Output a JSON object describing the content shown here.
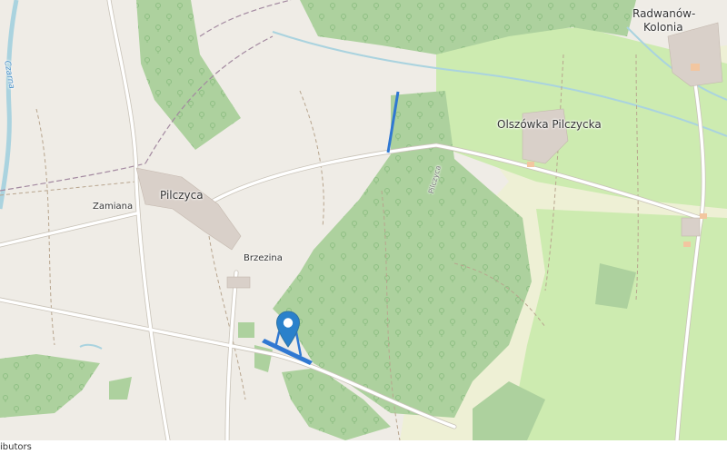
{
  "map": {
    "place_labels": {
      "pilczyca": "Pilczyca",
      "zamiana": "Zamiana",
      "brzezina": "Brzezina",
      "olszowka": "Olszówka Pilczycka",
      "radwanow_line1": "Radwanów-",
      "radwanow_line2": "Kolonia"
    },
    "water_label": "Czarna",
    "road_label": "Pilczyca",
    "colors": {
      "background": "#efece6",
      "forest": "#add19e",
      "farmland": "#eef0d5",
      "meadow": "#cdebb0",
      "road": "#ffffff",
      "river": "#aad3df",
      "marker": "#2a81cb",
      "highlight": "#3078d2"
    },
    "marker_icon": "map-pin-icon"
  },
  "attribution": "ibutors"
}
